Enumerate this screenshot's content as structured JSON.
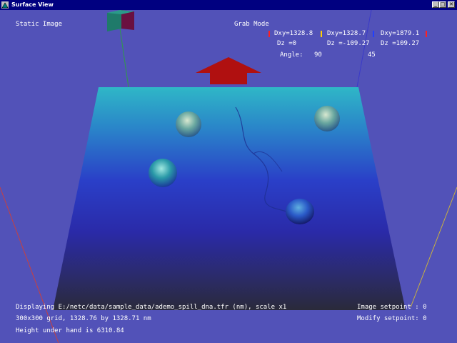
{
  "window": {
    "title": "Surface View",
    "buttons": {
      "minimize": "_",
      "maximize": "□",
      "close": "✕"
    }
  },
  "hud": {
    "static_label": "Static Image",
    "grab_mode": "Grab Mode",
    "dxy1": "Dxy=1328.8",
    "dxy2": "Dxy=1328.7",
    "dxy3": "Dxy=1879.1",
    "dz1": "Dz =0",
    "dz2": "Dz =-109.27",
    "dz3": "Dz =109.27",
    "angle_label": "Angle:",
    "angle_value": "90",
    "angle_value2": "45",
    "display_line": "Displaying E:/netc/data/sample_data/ademo_spill_dna.tfr (nm), scale x1",
    "grid_line": "300x300 grid, 1328.76 by 1328.71 nm",
    "height_line": "Height under hand is 6310.84",
    "image_setpoint": "Image setpoint : 0",
    "modify_setpoint": "Modify setpoint: 0"
  },
  "colors": {
    "background": "#5252b8",
    "arrow": "#b01010",
    "marker_red": "#ff2020",
    "marker_yellow": "#ffd000",
    "marker_blue": "#2040ff"
  },
  "icons": [
    "app-icon",
    "orientation-cube-icon",
    "up-arrow-icon"
  ]
}
